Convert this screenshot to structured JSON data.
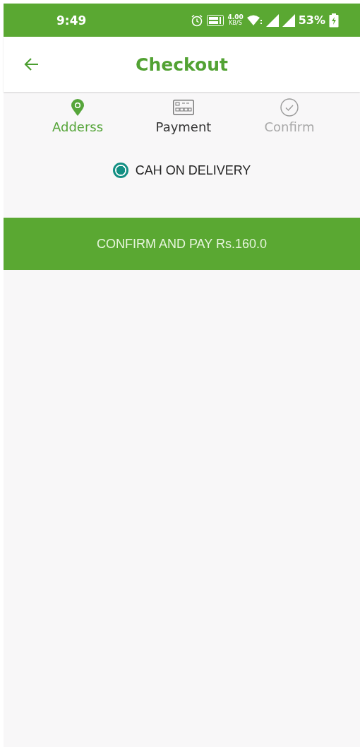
{
  "status_bar": {
    "time": "9:49",
    "speed_value": "4.00",
    "speed_unit": "KB/S",
    "battery": "53%"
  },
  "header": {
    "title": "Checkout"
  },
  "steps": [
    {
      "label": "Adderss",
      "kind": "pin",
      "completed": true,
      "selected": false
    },
    {
      "label": "Payment",
      "kind": "card",
      "completed": false,
      "selected": true
    },
    {
      "label": "Confirm",
      "kind": "check",
      "completed": false,
      "selected": false
    }
  ],
  "payment_options": [
    {
      "label": "CAH ON DELIVERY",
      "selected": true
    }
  ],
  "confirm_button": {
    "label": "CONFIRM AND PAY Rs.160.0"
  }
}
